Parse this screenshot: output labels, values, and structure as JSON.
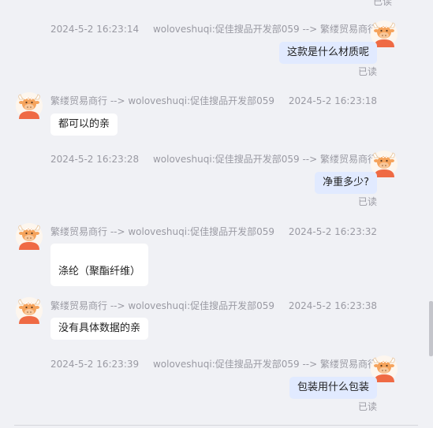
{
  "top_fragment": "已读",
  "messages": [
    {
      "direction": "out",
      "time": "2024-5-2 16:23:14",
      "route": "woloveshuqi:促佳搜品开发部059 --> 繁缕贸易商行",
      "text": "这款是什么材质呢",
      "status": "已读"
    },
    {
      "direction": "in",
      "time": "2024-5-2 16:23:18",
      "route": "繁缕贸易商行 --> woloveshuqi:促佳搜品开发部059",
      "text": "都可以的亲"
    },
    {
      "direction": "out",
      "time": "2024-5-2 16:23:28",
      "route": "woloveshuqi:促佳搜品开发部059 --> 繁缕贸易商行",
      "text": "净重多少?",
      "status": "已读"
    },
    {
      "direction": "in",
      "time": "2024-5-2 16:23:32",
      "route": "繁缕贸易商行 --> woloveshuqi:促佳搜品开发部059",
      "text": "涤纶（聚酯纤维）"
    },
    {
      "direction": "in",
      "time": "2024-5-2 16:23:38",
      "route": "繁缕贸易商行 --> woloveshuqi:促佳搜品开发部059",
      "text": "没有具体数据的亲"
    },
    {
      "direction": "out",
      "time": "2024-5-2 16:23:39",
      "route": "woloveshuqi:促佳搜品开发部059 --> 繁缕贸易商行",
      "text": "包装用什么包装",
      "status": "已读"
    }
  ],
  "colors": {
    "background": "#f0f1f5",
    "outgoing_bubble": "#e1eaff",
    "incoming_bubble": "#ffffff",
    "meta_text": "#9a9aa3",
    "avatar_face": "#f5a35c",
    "avatar_shirt": "#ef6a44"
  },
  "icons": {
    "avatar": "cartoon-bull-avatar-icon"
  }
}
